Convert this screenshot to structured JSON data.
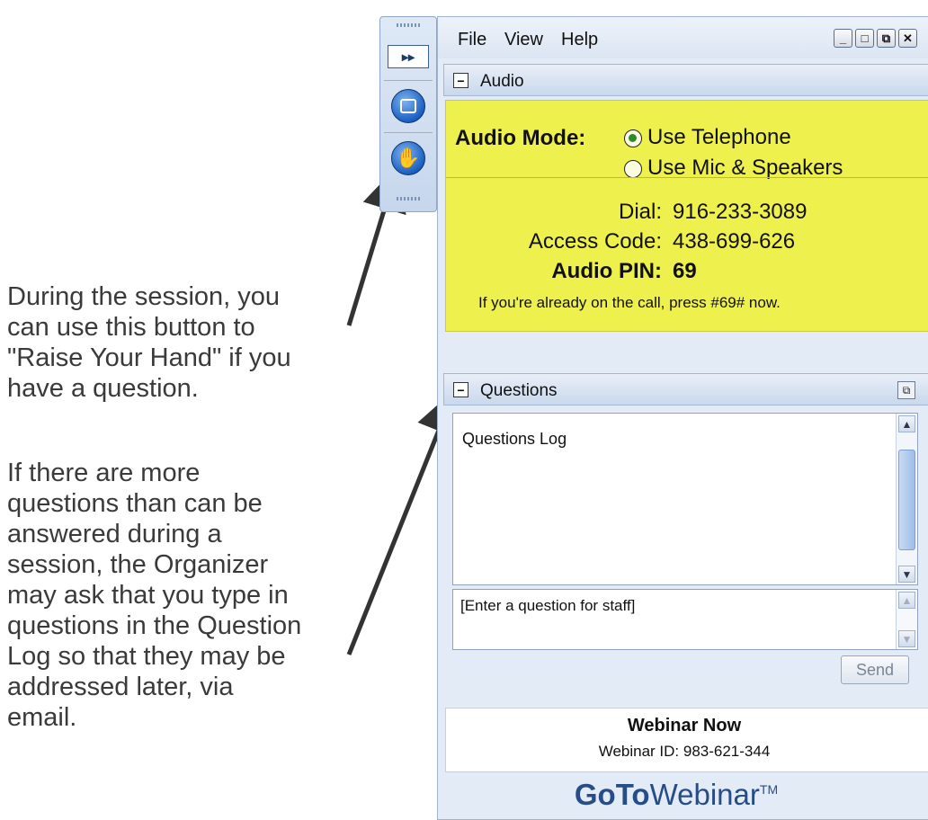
{
  "annotations": {
    "raise_hand_note": [
      "During the session, you",
      "can use this button to",
      "\"Raise Your Hand\" if you",
      "have a question."
    ],
    "questions_note": [
      "If there are more",
      "questions than can be",
      "answered during a",
      "session, the Organizer",
      "may ask that you type in",
      "questions in the Question",
      "Log so that they may be",
      "addressed later, via",
      "email."
    ]
  },
  "toolbar": {
    "expand_icon": "▸▸",
    "screen_icon": "screen-icon",
    "hand_icon": "raise-hand-icon"
  },
  "menu": {
    "file": "File",
    "view": "View",
    "help": "Help"
  },
  "window_buttons": {
    "minimize": "_",
    "maximize": "□",
    "restore": "⧉",
    "close": "✕"
  },
  "audio": {
    "title": "Audio",
    "mode_label": "Audio Mode:",
    "options": [
      "Use Telephone",
      "Use Mic & Speakers"
    ],
    "selected": "Use Telephone",
    "dial_label": "Dial:",
    "dial_value": "916-233-3089",
    "access_label": "Access Code:",
    "access_value": "438-699-626",
    "pin_label": "Audio PIN:",
    "pin_value": "69",
    "note": "If you're already on the call, press #69# now."
  },
  "questions": {
    "title": "Questions",
    "log_text": "Questions Log",
    "input_placeholder": "[Enter a question for staff]",
    "send_label": "Send"
  },
  "footer": {
    "title": "Webinar Now",
    "webinar_id": "Webinar ID: 983-621-344"
  },
  "brand": {
    "goto": "GoTo",
    "webinar": "Webinar",
    "tm": "TM"
  }
}
